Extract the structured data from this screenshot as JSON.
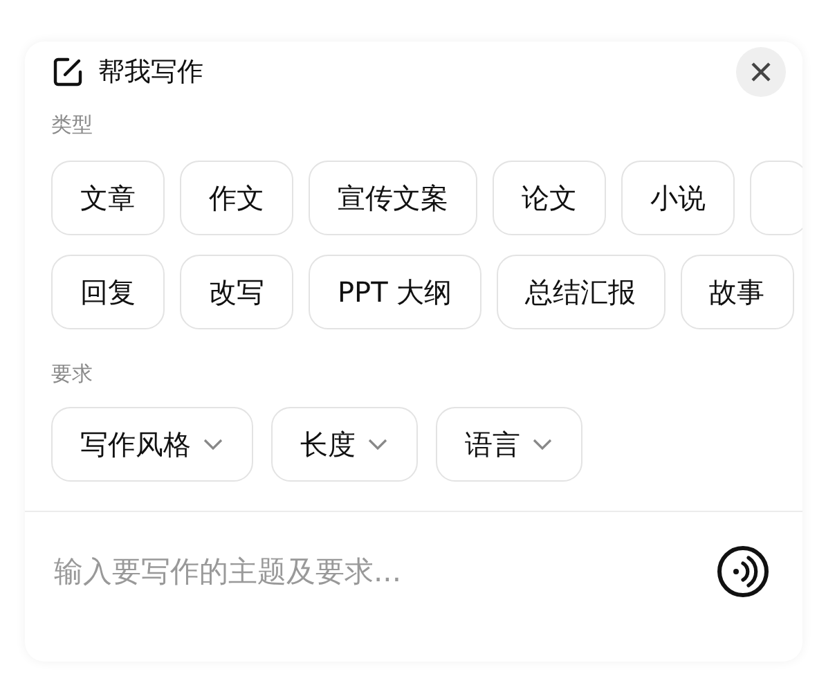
{
  "header": {
    "title": "帮我写作"
  },
  "type_section": {
    "label": "类型",
    "rows": [
      {
        "chips": [
          {
            "kind": "text",
            "label": "文章"
          },
          {
            "kind": "text",
            "label": "作文"
          },
          {
            "kind": "text",
            "label": "宣传文案"
          },
          {
            "kind": "text",
            "label": "论文"
          },
          {
            "kind": "text",
            "label": "小说"
          },
          {
            "kind": "cut_off"
          }
        ]
      },
      {
        "chips": [
          {
            "kind": "text",
            "label": "回复"
          },
          {
            "kind": "text",
            "label": "改写"
          },
          {
            "kind": "text",
            "label": "PPT 大纲"
          },
          {
            "kind": "text",
            "label": "总结汇报"
          },
          {
            "kind": "text",
            "label": "故事"
          }
        ]
      }
    ]
  },
  "requirement_section": {
    "label": "要求",
    "dropdowns": [
      {
        "label": "写作风格"
      },
      {
        "label": "长度"
      },
      {
        "label": "语言"
      }
    ]
  },
  "input": {
    "placeholder": "输入要写作的主题及要求..."
  }
}
